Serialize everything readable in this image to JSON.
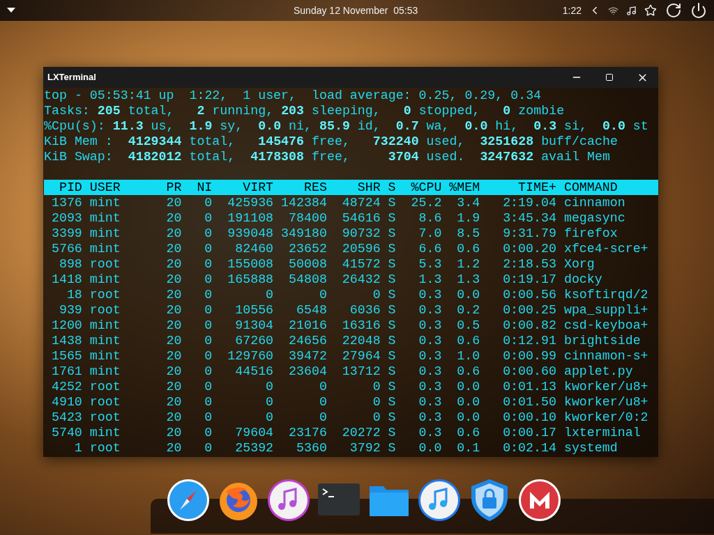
{
  "top_bar": {
    "clock": "Sunday 12 November  05:53",
    "uptime": "1:22"
  },
  "window": {
    "title": "LXTerminal",
    "summary": [
      "top - 05:53:41 up  1:22,  1 user,  load average: 0.25, 0.29, 0.34",
      "Tasks: **205** total,   **2** running, **203** sleeping,   **0** stopped,   **0** zombie",
      "%Cpu(s): **11.3** us,  **1.9** sy,  **0.0** ni, **85.9** id,  **0.7** wa,  **0.0** hi,  **0.3** si,  **0.0** st",
      "KiB Mem :  **4129344** total,   **145476** free,   **732240** used,  **3251628** buff/cache",
      "KiB Swap:  **4182012** total,  **4178308** free,     **3704** used.  **3247632** avail Mem"
    ],
    "table": {
      "columns": [
        "PID",
        "USER",
        "PR",
        "NI",
        "VIRT",
        "RES",
        "SHR",
        "S",
        "%CPU",
        "%MEM",
        "TIME+",
        "COMMAND"
      ],
      "rows": [
        [
          "1376",
          "mint",
          "20",
          "0",
          "425936",
          "142384",
          "48724",
          "S",
          "25.2",
          "3.4",
          "2:19.04",
          "cinnamon"
        ],
        [
          "2093",
          "mint",
          "20",
          "0",
          "191108",
          "78400",
          "54616",
          "S",
          "8.6",
          "1.9",
          "3:45.34",
          "megasync"
        ],
        [
          "3399",
          "mint",
          "20",
          "0",
          "939048",
          "349180",
          "90732",
          "S",
          "7.0",
          "8.5",
          "9:31.79",
          "firefox"
        ],
        [
          "5766",
          "mint",
          "20",
          "0",
          "82460",
          "23652",
          "20596",
          "S",
          "6.6",
          "0.6",
          "0:00.20",
          "xfce4-scre+"
        ],
        [
          "898",
          "root",
          "20",
          "0",
          "155008",
          "50008",
          "41572",
          "S",
          "5.3",
          "1.2",
          "2:18.53",
          "Xorg"
        ],
        [
          "1418",
          "mint",
          "20",
          "0",
          "165888",
          "54808",
          "26432",
          "S",
          "1.3",
          "1.3",
          "0:19.17",
          "docky"
        ],
        [
          "18",
          "root",
          "20",
          "0",
          "0",
          "0",
          "0",
          "S",
          "0.3",
          "0.0",
          "0:00.56",
          "ksoftirqd/2"
        ],
        [
          "939",
          "root",
          "20",
          "0",
          "10556",
          "6548",
          "6036",
          "S",
          "0.3",
          "0.2",
          "0:00.25",
          "wpa_suppli+"
        ],
        [
          "1200",
          "mint",
          "20",
          "0",
          "91304",
          "21016",
          "16316",
          "S",
          "0.3",
          "0.5",
          "0:00.82",
          "csd-keyboa+"
        ],
        [
          "1438",
          "mint",
          "20",
          "0",
          "67260",
          "24656",
          "22048",
          "S",
          "0.3",
          "0.6",
          "0:12.91",
          "brightside"
        ],
        [
          "1565",
          "mint",
          "20",
          "0",
          "129760",
          "39472",
          "27964",
          "S",
          "0.3",
          "1.0",
          "0:00.99",
          "cinnamon-s+"
        ],
        [
          "1761",
          "mint",
          "20",
          "0",
          "44516",
          "23604",
          "13712",
          "S",
          "0.3",
          "0.6",
          "0:00.60",
          "applet.py"
        ],
        [
          "4252",
          "root",
          "20",
          "0",
          "0",
          "0",
          "0",
          "S",
          "0.3",
          "0.0",
          "0:01.13",
          "kworker/u8+"
        ],
        [
          "4910",
          "root",
          "20",
          "0",
          "0",
          "0",
          "0",
          "S",
          "0.3",
          "0.0",
          "0:01.50",
          "kworker/u8+"
        ],
        [
          "5423",
          "root",
          "20",
          "0",
          "0",
          "0",
          "0",
          "S",
          "0.3",
          "0.0",
          "0:00.10",
          "kworker/0:2"
        ],
        [
          "5740",
          "mint",
          "20",
          "0",
          "79604",
          "23176",
          "20272",
          "S",
          "0.3",
          "0.6",
          "0:00.17",
          "lxterminal"
        ],
        [
          "1",
          "root",
          "20",
          "0",
          "25392",
          "5360",
          "3792",
          "S",
          "0.0",
          "0.1",
          "0:02.14",
          "systemd"
        ]
      ]
    }
  }
}
